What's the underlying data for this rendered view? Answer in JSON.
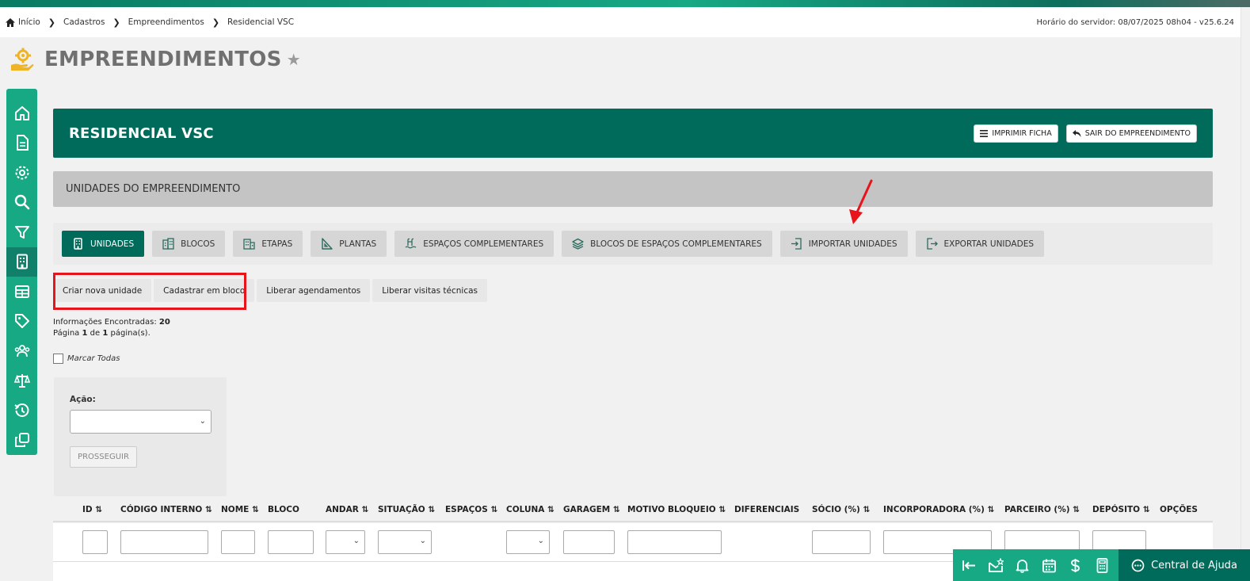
{
  "breadcrumb": [
    {
      "label": "Início"
    },
    {
      "label": "Cadastros"
    },
    {
      "label": "Empreendimentos"
    },
    {
      "label": "Residencial VSC"
    }
  ],
  "server_time": "Horário do servidor: 08/07/2025 08h04 - v25.6.24",
  "page_title": "EMPREENDIMENTOS",
  "hero": {
    "title": "RESIDENCIAL VSC",
    "print_label": "IMPRIMIR FICHA",
    "exit_label": "SAIR DO EMPREENDIMENTO"
  },
  "section_title": "UNIDADES DO EMPREENDIMENTO",
  "tabs": [
    {
      "label": "UNIDADES",
      "icon": "building-icon",
      "active": true
    },
    {
      "label": "BLOCOS",
      "icon": "blocks-icon"
    },
    {
      "label": "ETAPAS",
      "icon": "stages-icon"
    },
    {
      "label": "PLANTAS",
      "icon": "ruler-triangle-icon"
    },
    {
      "label": "ESPAÇOS COMPLEMENTARES",
      "icon": "pool-icon"
    },
    {
      "label": "BLOCOS DE ESPAÇOS COMPLEMENTARES",
      "icon": "layers-icon"
    },
    {
      "label": "IMPORTAR UNIDADES",
      "icon": "import-icon"
    },
    {
      "label": "EXPORTAR UNIDADES",
      "icon": "export-icon"
    }
  ],
  "actions": {
    "create_unit": "Criar nova unidade",
    "bulk_register": "Cadastrar em bloco",
    "release_scheduling": "Liberar agendamentos",
    "release_visits": "Liberar visitas técnicas"
  },
  "info": {
    "found_label": "Informações Encontradas:",
    "found_count": "20",
    "page_word": "Página",
    "page_current": "1",
    "page_of": "de",
    "page_total": "1",
    "page_suffix": "página(s)."
  },
  "mark_all": "Marcar Todas",
  "action_panel": {
    "label": "Ação:",
    "proceed": "PROSSEGUIR"
  },
  "table": {
    "columns": [
      "ID",
      "CÓDIGO INTERNO",
      "NOME",
      "BLOCO",
      "ANDAR",
      "SITUAÇÃO",
      "ESPAÇOS",
      "COLUNA",
      "GARAGEM",
      "MOTIVO BLOQUEIO",
      "DIFERENCIAIS",
      "SÓCIO (%)",
      "INCORPORADORA (%)",
      "PARCEIRO (%)",
      "DEPÓSITO",
      "OPÇÕES"
    ]
  },
  "help": {
    "label": "Central de Ajuda"
  },
  "colors": {
    "brand_dark": "#006b5a",
    "brand_light": "#17a884",
    "highlight": "#e8141b"
  }
}
